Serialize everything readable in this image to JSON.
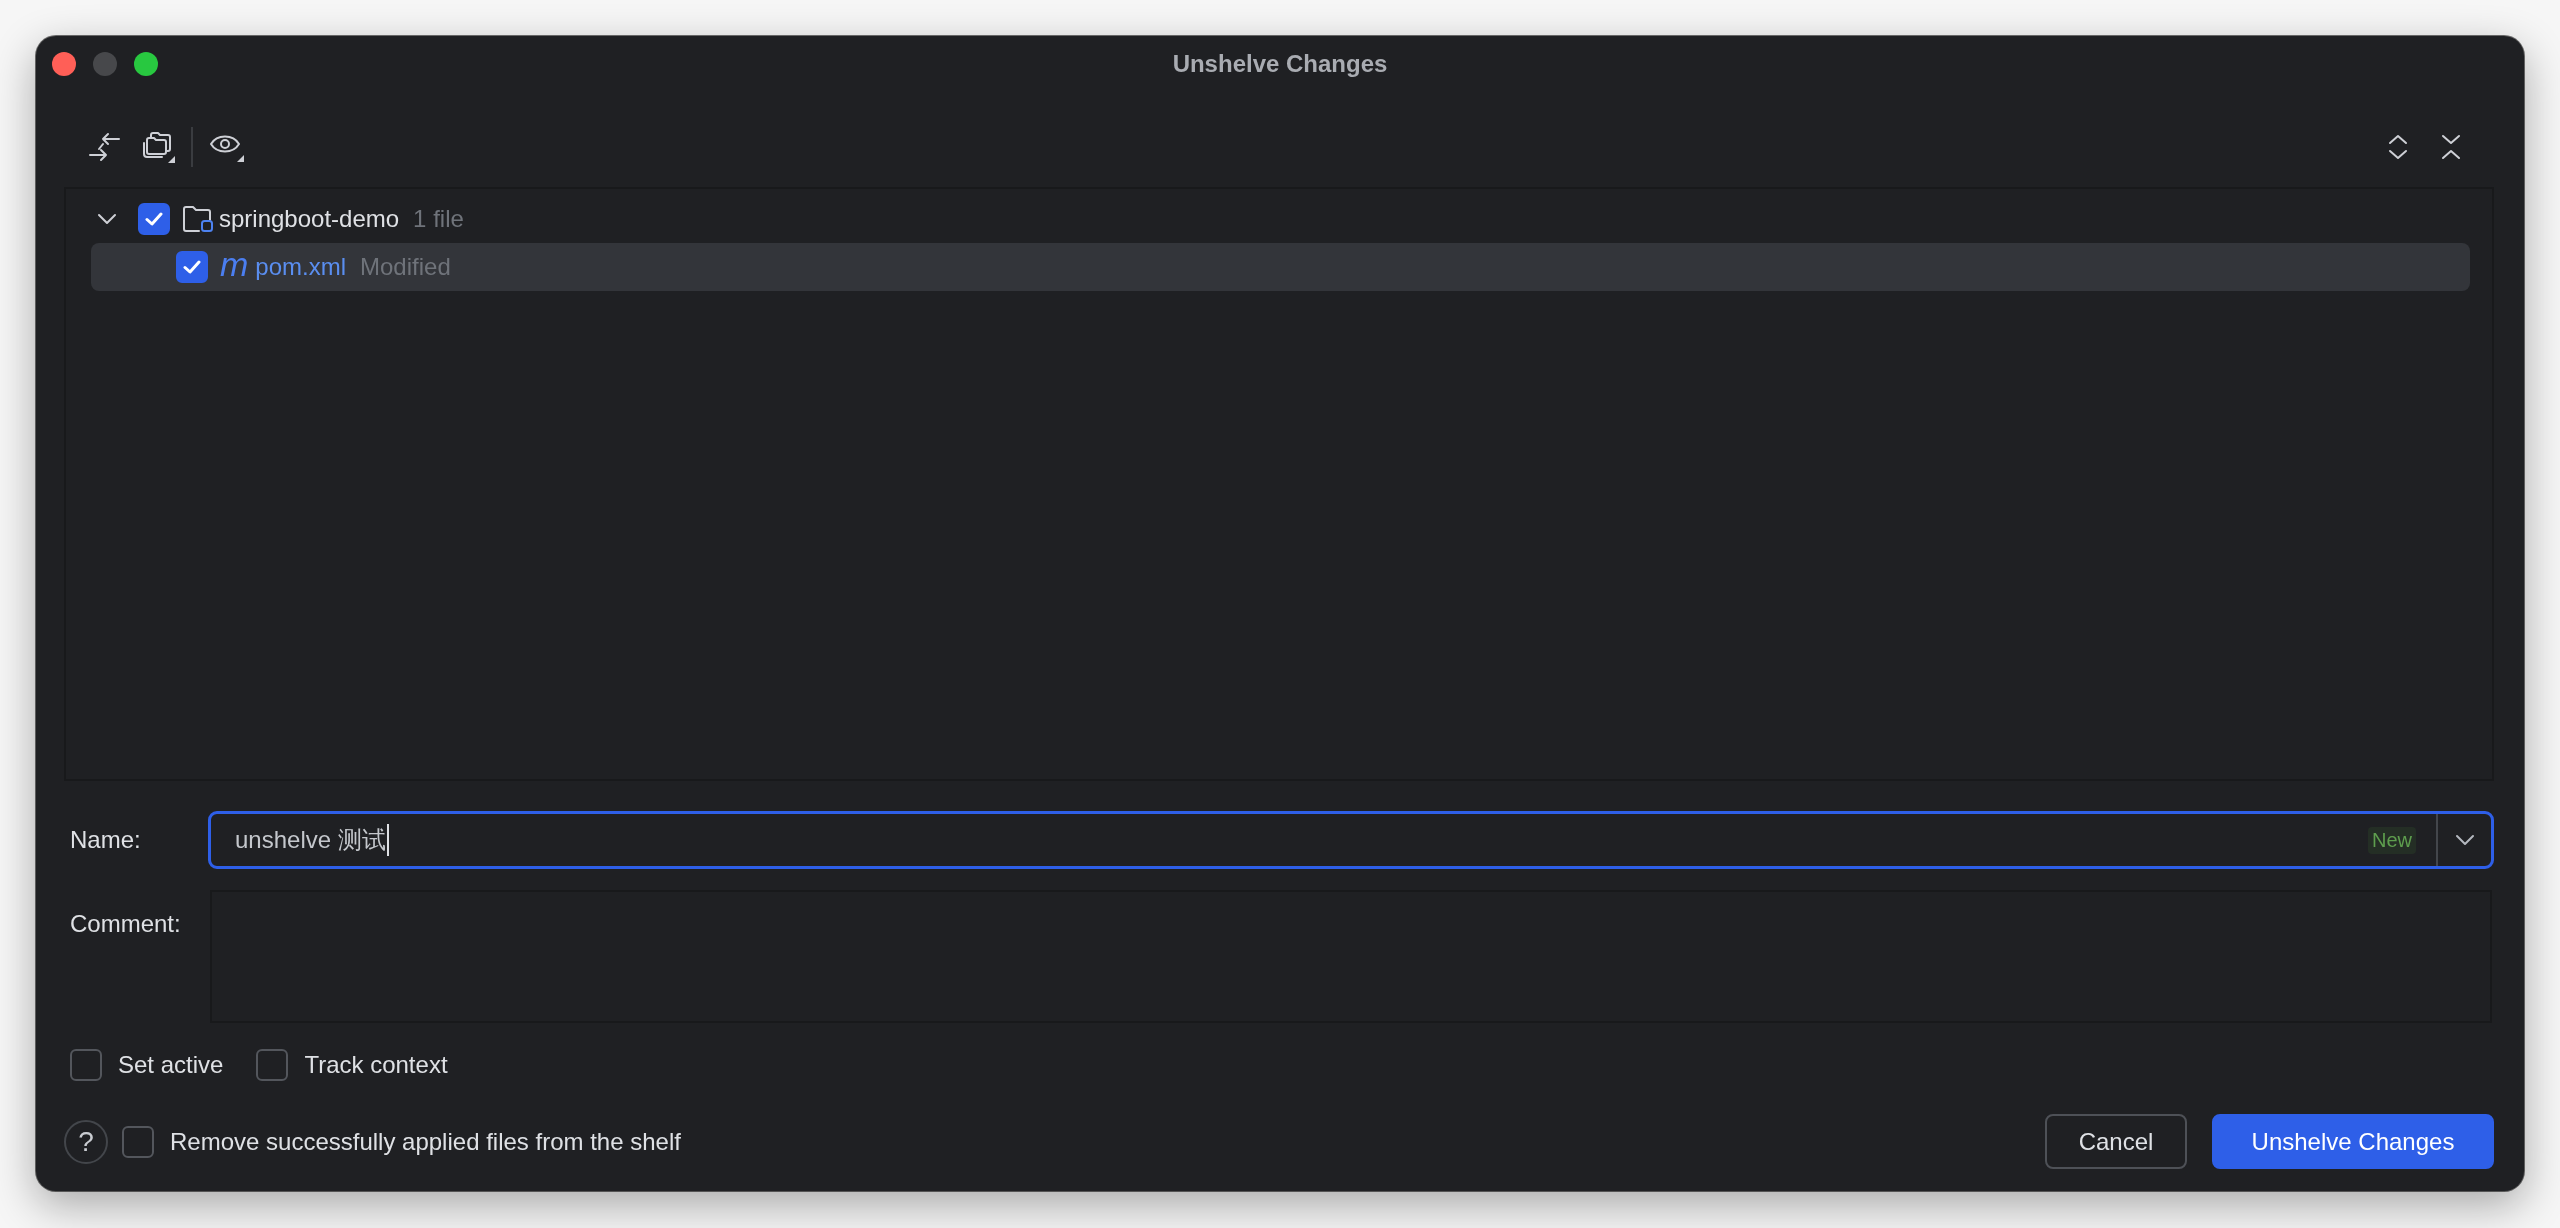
{
  "window": {
    "title": "Unshelve Changes",
    "controls": [
      {
        "kind": "close",
        "disabled": false
      },
      {
        "kind": "minimize",
        "disabled": true
      },
      {
        "kind": "zoom",
        "disabled": false
      }
    ]
  },
  "changes_tree": {
    "items": [
      {
        "kind": "module",
        "label": "springboot-demo",
        "detail": "1 file",
        "checked": true,
        "expanded": true,
        "selected": false,
        "children": [
          {
            "kind": "file",
            "type_glyph": "m",
            "label": "pom.xml",
            "detail": "Modified",
            "checked": true,
            "selected": true
          }
        ]
      }
    ]
  },
  "form": {
    "name": {
      "label": "Name:",
      "value": "unshelve 测试",
      "badge": "New",
      "focused": true
    },
    "comment": {
      "label": "Comment:"
    }
  },
  "options": [
    {
      "label": "Set active",
      "checked": false
    },
    {
      "label": "Track context",
      "checked": false
    }
  ],
  "footer": {
    "help": "?",
    "remove_option": {
      "label": "Remove successfully applied files from the shelf",
      "checked": false
    },
    "buttons": [
      {
        "label": "Cancel",
        "kind": "secondary"
      },
      {
        "label": "Unshelve Changes",
        "kind": "primary"
      }
    ]
  }
}
